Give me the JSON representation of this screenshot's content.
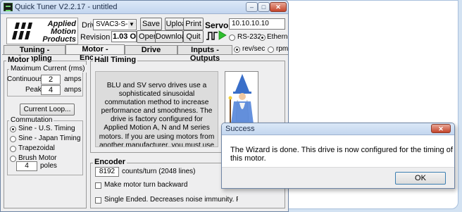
{
  "window": {
    "title": "Quick Tuner  V2.2.17 - untitled"
  },
  "logo": {
    "line1": "Applied",
    "line2": "Motion",
    "line3": "Products"
  },
  "header": {
    "drive_label": "Drive",
    "drive_value": "SVAC3-S-120",
    "revision_label": "Revision",
    "revision_value": "1.03 O",
    "save": "Save",
    "upload": "Upload",
    "print": "Print",
    "open": "Open",
    "download": "Download",
    "quit": "Quit",
    "servo_label": "Servo",
    "ip_value": "10.10.10.10",
    "rs232": "RS-232",
    "ethernet": "Ethernet"
  },
  "tabs": [
    {
      "label": "Tuning - Sampling"
    },
    {
      "label": "Motor - Encoder"
    },
    {
      "label": "Drive"
    },
    {
      "label": "Inputs - Outputs"
    }
  ],
  "units": {
    "revsec": "rev/sec",
    "rpm": "rpm"
  },
  "motor": {
    "title": "Motor",
    "max_current_title": "Maximum Current (rms)",
    "continuous_label": "Continuous",
    "continuous_value": "2",
    "peak_label": "Peak",
    "peak_value": "4",
    "amps": "amps",
    "current_loop_btn": "Current Loop...",
    "commutation_title": "Commutation",
    "options": [
      "Sine - U.S. Timing",
      "Sine - Japan Timing",
      "Trapezoidal",
      "Brush Motor"
    ],
    "poles_value": "4",
    "poles_label": "poles"
  },
  "hall": {
    "title": "Hall Timing",
    "text": "BLU and SV servo drives use a sophisticated sinusoidal commutation method to increase performance and smoothness.  The drive is factory configured for Applied Motion A, N and M series motors.  If you are using motors from another manufacturer, you must use the Timing Wizard to correctly configure the drive for your motor.  But first, be sure to enter the correct motor pole count and encoder resolution."
  },
  "encoder": {
    "title": "Encoder",
    "counts_value": "8192",
    "counts_label": "counts/turn (2048 lines)",
    "backward_label": "Make motor turn backward",
    "single_ended_label": "Single Ended.  Decreases noise immunity. Prevents error detection."
  },
  "dialog": {
    "title": "Success",
    "message": "The Wizard is done.  This drive is now configured for the timing of this motor.",
    "ok": "OK"
  },
  "colors": {
    "titlebar": "#c3d6ef",
    "window_bg": "#eeeeef",
    "play_green": "#2fbf2f",
    "close_red": "#c4442a"
  }
}
